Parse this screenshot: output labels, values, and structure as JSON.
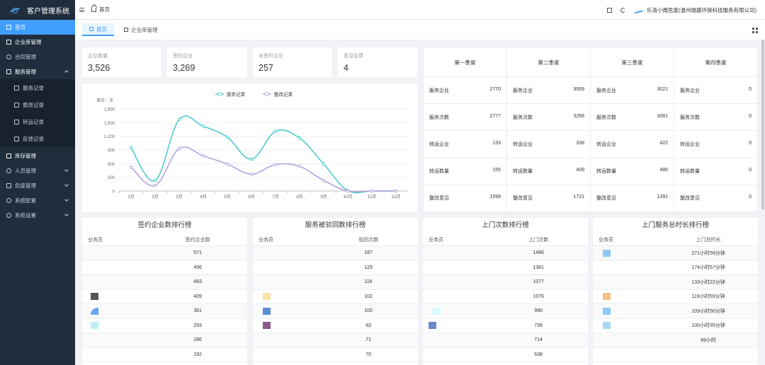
{
  "app": {
    "title": "客户管理系统"
  },
  "sidebar": {
    "items": [
      {
        "label": "首页"
      },
      {
        "label": "企业库管理"
      },
      {
        "label": "合同管理"
      },
      {
        "label": "服务管理"
      },
      {
        "label": "服务记录"
      },
      {
        "label": "整改记录"
      },
      {
        "label": "转运记录"
      },
      {
        "label": "反馈记录"
      },
      {
        "label": "库存管理"
      },
      {
        "label": "人员管理"
      },
      {
        "label": "危废管理"
      },
      {
        "label": "系统配置"
      },
      {
        "label": "系统设置"
      }
    ]
  },
  "topbar": {
    "breadcrumb": "首页",
    "user": "乐清小微危废(温州瑞盛环保科技服务有限公司)"
  },
  "tabs": [
    {
      "label": "首页"
    },
    {
      "label": "企业库管理"
    }
  ],
  "stats": [
    {
      "label": "企业数量",
      "value": "3,526"
    },
    {
      "label": "签约企业",
      "value": "3,269"
    },
    {
      "label": "未签约企业",
      "value": "257"
    },
    {
      "label": "意见反馈",
      "value": "4"
    }
  ],
  "chart_data": {
    "type": "line",
    "x": [
      "1月",
      "2月",
      "3月",
      "4月",
      "5月",
      "6月",
      "7月",
      "8月",
      "9月",
      "10月",
      "11月",
      "12月"
    ],
    "series": [
      {
        "name": "服务记录",
        "color": "#4fcbd0",
        "values": [
          950,
          230,
          1570,
          1420,
          1180,
          700,
          1310,
          1160,
          590,
          10,
          0,
          0
        ]
      },
      {
        "name": "整改记录",
        "color": "#b6a2de",
        "values": [
          520,
          120,
          930,
          770,
          590,
          370,
          580,
          540,
          230,
          0,
          0,
          0
        ]
      }
    ],
    "ylabel": "单位：次",
    "yticks": [
      "0",
      "300",
      "600",
      "900",
      "1,200",
      "1,500",
      "1,800"
    ],
    "ylim": [
      0,
      1800
    ],
    "legend": "top-center"
  },
  "quarters": {
    "headers": [
      "第一季度",
      "第二季度",
      "第三季度",
      "第四季度"
    ],
    "rows": [
      {
        "label": "服务企业",
        "values": [
          "2770",
          "3069",
          "3021",
          "0"
        ]
      },
      {
        "label": "服务次数",
        "values": [
          "2777",
          "3266",
          "3081",
          "0"
        ]
      },
      {
        "label": "转运企业",
        "values": [
          "133",
          "338",
          "422",
          "0"
        ]
      },
      {
        "label": "转运数量",
        "values": [
          "155",
          "409",
          "486",
          "0"
        ]
      },
      {
        "label": "整改意见",
        "values": [
          "1599",
          "1721",
          "1391",
          "0"
        ]
      }
    ]
  },
  "rankings": [
    {
      "title": "签约企业数排行榜",
      "col1": "业务员",
      "col2": "签约企业数",
      "rows": [
        "571",
        "496",
        "483",
        "409",
        "361",
        "293",
        "286",
        "192"
      ],
      "marks": [
        null,
        null,
        null,
        "#555555",
        "#6aa6ee",
        "#bff0f7",
        null,
        null
      ]
    },
    {
      "title": "服务被驳回数排行榜",
      "col1": "业务员",
      "col2": "驳回次数",
      "rows": [
        "187",
        "129",
        "116",
        "102",
        "100",
        "83",
        "71",
        "70"
      ],
      "marks": [
        null,
        null,
        null,
        "#fbe3a8",
        "#5b8fd6",
        "#8b5a8c",
        null,
        null
      ]
    },
    {
      "title": "上门次数排行榜",
      "col1": "业务员",
      "col2": "上门次数",
      "rows": [
        "1486",
        "1381",
        "1077",
        "1076",
        "990",
        "739",
        "714",
        "638"
      ],
      "marks": [
        null,
        null,
        null,
        null,
        "#d9fbff",
        "#6b86c9",
        null,
        null
      ]
    },
    {
      "title": "上门服务总时长排行榜",
      "col1": "业务员",
      "col2": "上门总时长",
      "rows": [
        "271小时59分钟",
        "174小时57分钟",
        "133小时22分钟",
        "119小时59分钟",
        "109小时50分钟",
        "100小时35分钟",
        "89小时",
        ""
      ],
      "marks": [
        "#8ec9f7",
        null,
        null,
        "#f7c08a",
        "#8ec9f7",
        "#a9d8f5",
        null,
        null
      ]
    }
  ]
}
